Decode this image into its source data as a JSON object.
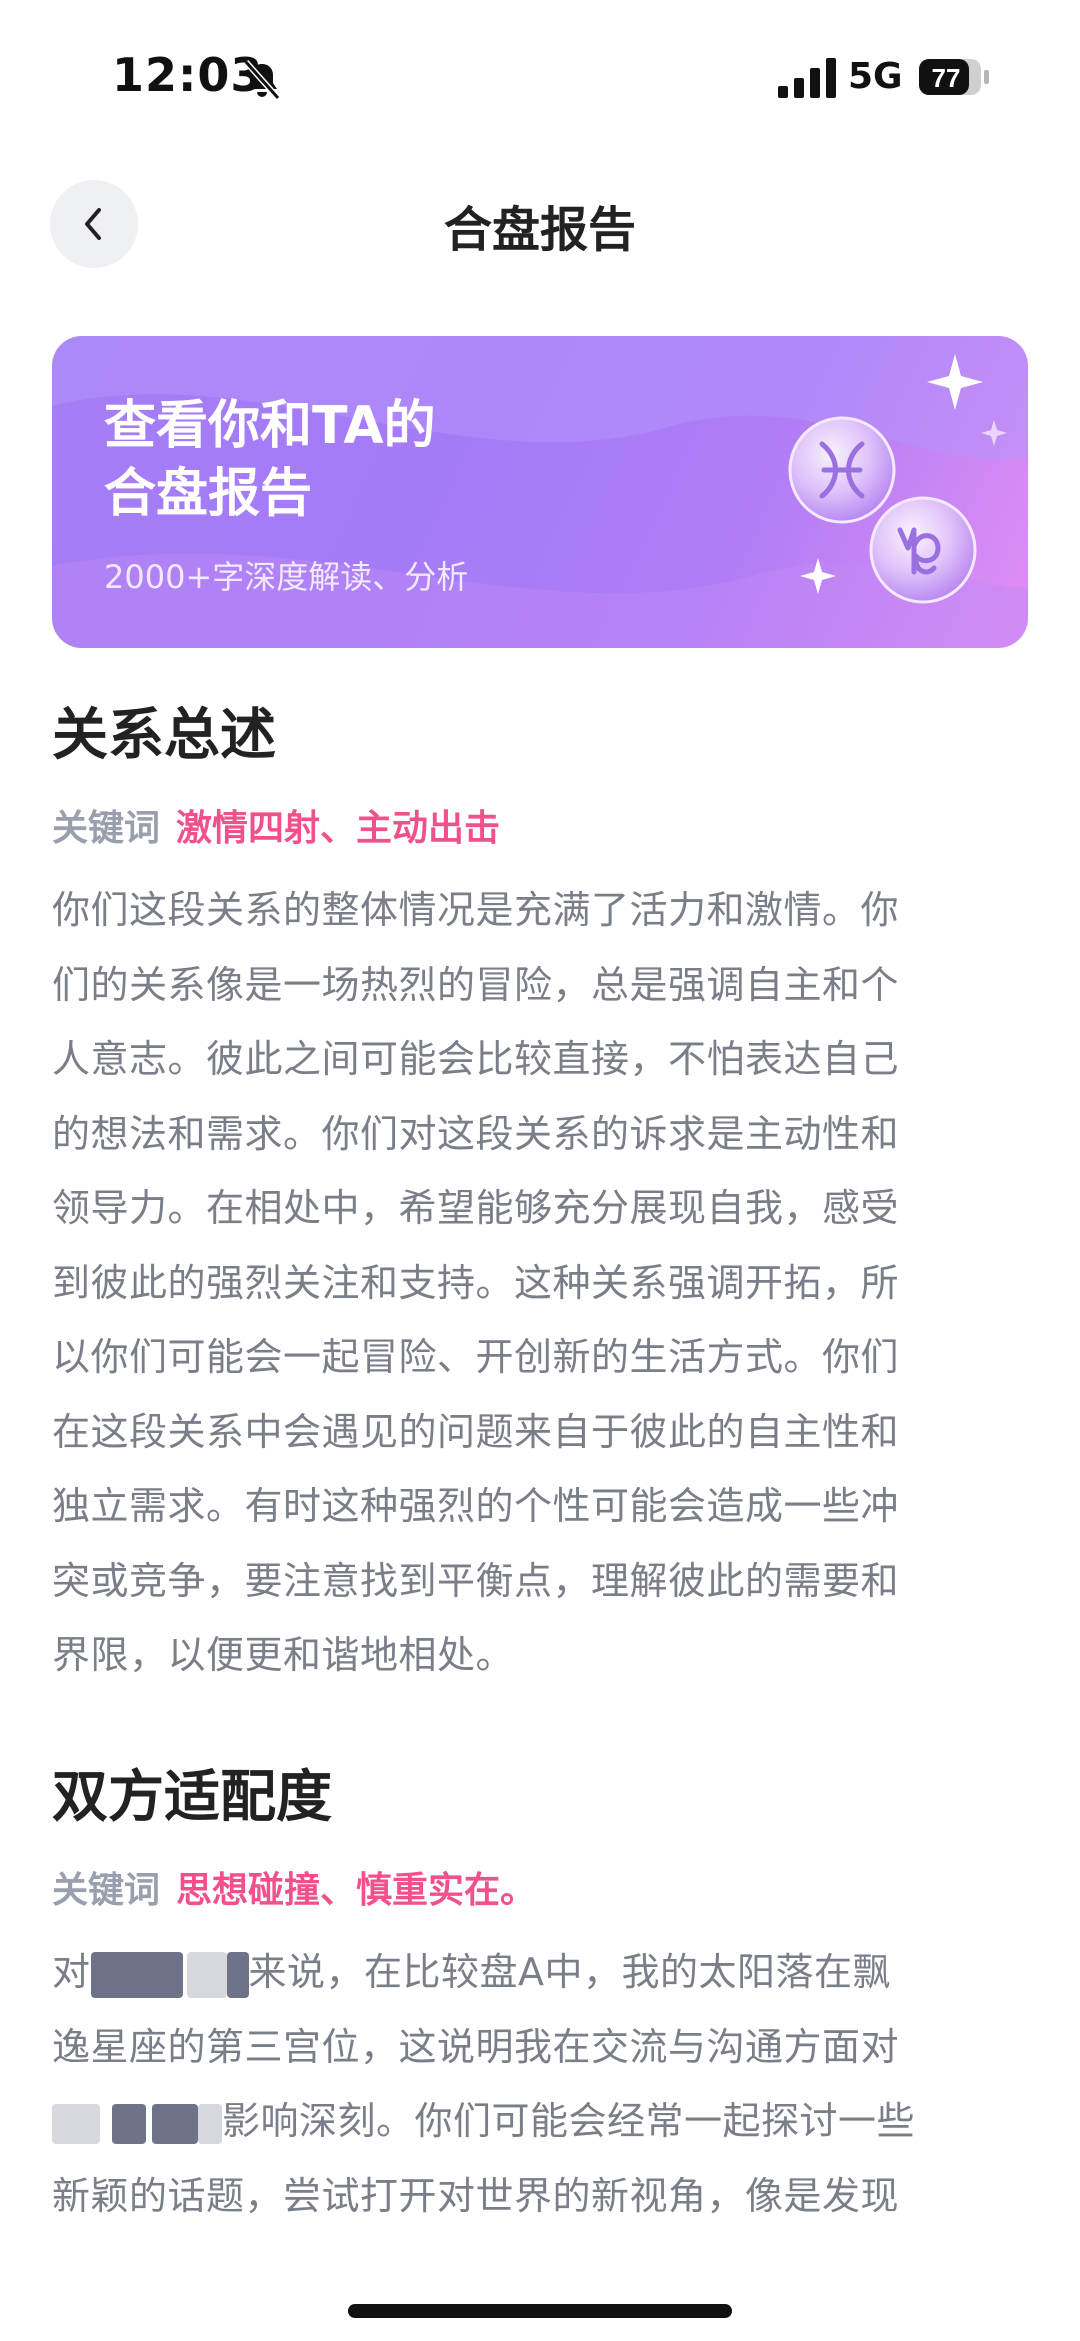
{
  "status_bar": {
    "time": "12:03",
    "network": "5G",
    "battery": "77"
  },
  "header": {
    "title": "合盘报告"
  },
  "banner": {
    "title_line1": "查看你和TA的",
    "title_line2": "合盘报告",
    "subtitle": "2000+字深度解读、分析",
    "icons": [
      "pisces-icon",
      "capricorn-icon"
    ]
  },
  "sections": [
    {
      "title": "关系总述",
      "keyword_label": "关键词",
      "keywords": "激情四射、主动出击",
      "lines": [
        "你们这段关系的整体情况是充满了活力和激情。你",
        "们的关系像是一场热烈的冒险，总是强调自主和个",
        "人意志。彼此之间可能会比较直接，不怕表达自己",
        "的想法和需求。你们对这段关系的诉求是主动性和",
        "领导力。在相处中，希望能够充分展现自我，感受",
        "到彼此的强烈关注和支持。这种关系强调开拓，所",
        "以你们可能会一起冒险、开创新的生活方式。你们",
        "在这段关系中会遇见的问题来自于彼此的自主性和",
        "独立需求。有时这种强烈的个性可能会造成一些冲",
        "突或竞争，要注意找到平衡点，理解彼此的需要和",
        "界限，以便更和谐地相处。"
      ]
    },
    {
      "title": "双方适配度",
      "keyword_label": "关键词",
      "keywords": "思想碰撞、慎重实在。",
      "line1_start": "对",
      "line1_end": "来说，在比较盘A中，我的太阳落在飘",
      "line2": "逸星座的第三宫位，这说明我在交流与沟通方面对",
      "line3_end": "影响深刻。你们可能会经常一起探讨一些",
      "line4": "新颖的话题，尝试打开对世界的新视角，像是发现"
    }
  ]
}
